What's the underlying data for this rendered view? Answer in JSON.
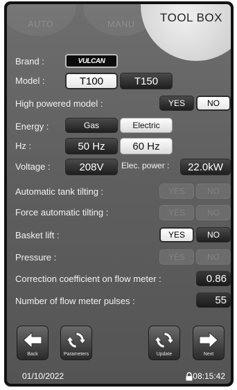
{
  "header": {
    "tabs": [
      "AUTO",
      "MANU"
    ],
    "title": "TOOL BOX"
  },
  "brand": {
    "label": "Brand :",
    "logo_text": "VULCAN"
  },
  "model": {
    "label": "Model :",
    "options": [
      "T100",
      "T150"
    ],
    "selected": "T100"
  },
  "high_powered": {
    "label": "High powered model :",
    "yes": "YES",
    "no": "NO",
    "selected": "NO"
  },
  "energy": {
    "label": "Energy :",
    "options": [
      "Gas",
      "Electric"
    ],
    "selected": "Electric"
  },
  "hz": {
    "label": "Hz :",
    "options": [
      "50 Hz",
      "60 Hz"
    ],
    "selected": "60 Hz"
  },
  "voltage": {
    "label": "Voltage :",
    "value": "208V"
  },
  "elec_power": {
    "label": "Elec. power :",
    "value": "22.0kW"
  },
  "auto_tank_tilting": {
    "label": "Automatic tank tilting :",
    "yes": "YES",
    "no": "NO"
  },
  "force_auto_tilting": {
    "label": "Force automatic tilting :",
    "yes": "YES",
    "no": "NO"
  },
  "basket_lift": {
    "label": "Basket lift :",
    "yes": "YES",
    "no": "NO",
    "selected": "YES"
  },
  "pressure": {
    "label": "Pressure :",
    "yes": "YES",
    "no": "NO"
  },
  "correction_coefficient": {
    "label": "Correction coefficient on flow meter :",
    "value": "0.86"
  },
  "flow_meter_pulses": {
    "label": "Number of flow meter pulses :",
    "value": "55"
  },
  "nav": {
    "back": "Back",
    "parameters": "Parameters",
    "update": "Update",
    "next": "Next"
  },
  "footer": {
    "date": "01/10/2022",
    "time": "08:15:42"
  },
  "icons": [
    "arrow-left-icon",
    "refresh-icon",
    "refresh-icon",
    "arrow-right-icon",
    "lock-icon"
  ]
}
